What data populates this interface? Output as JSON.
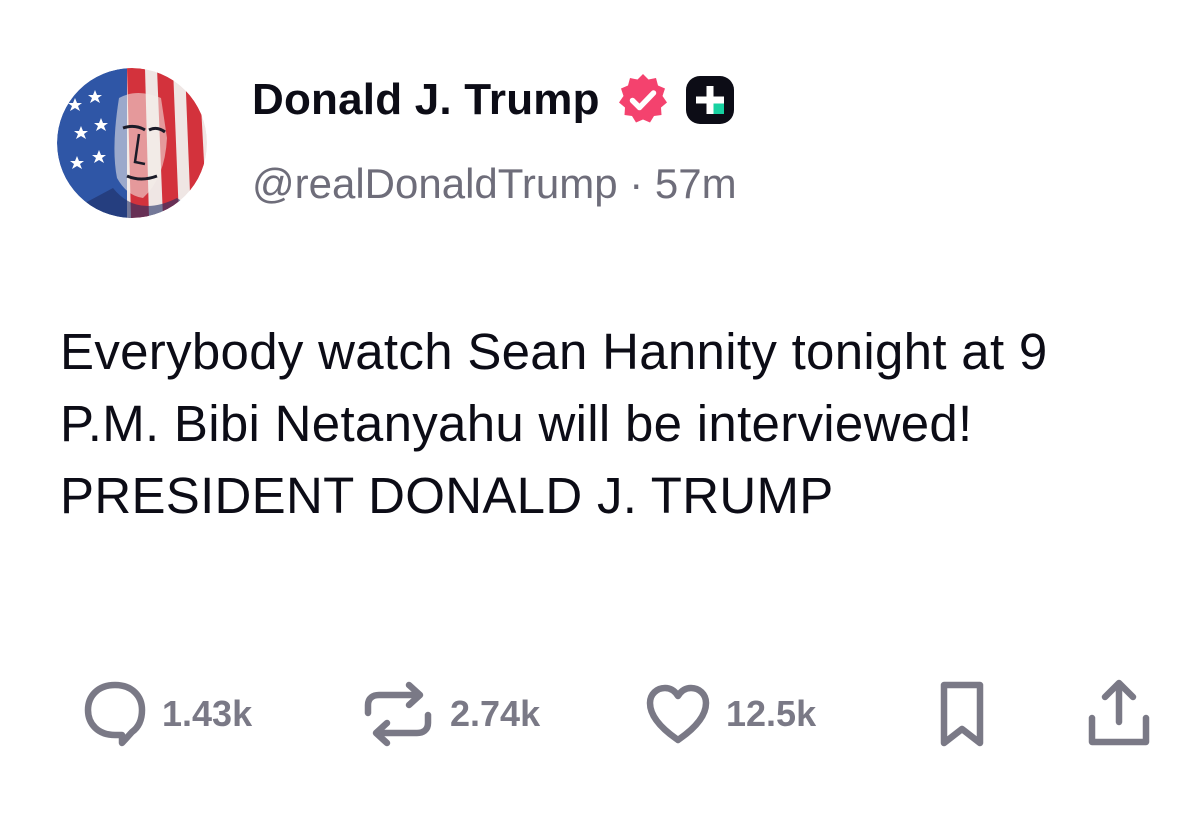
{
  "author": {
    "display_name": "Donald J. Trump",
    "handle": "@realDonaldTrump",
    "separator": "·",
    "time_ago": "57m",
    "verified_badge_icon": "verified-check-icon",
    "verified_badge_color": "#f4426e",
    "plus_badge_icon": "plus-badge-icon"
  },
  "post": {
    "text": "Everybody watch Sean Hannity tonight at 9 P.M. Bibi Netanyahu will be interviewed! PRESIDENT DONALD J. TRUMP"
  },
  "actions": {
    "replies": {
      "icon": "reply-bubble-icon",
      "count": "1.43k"
    },
    "retruths": {
      "icon": "repost-icon",
      "count": "2.74k"
    },
    "likes": {
      "icon": "heart-icon",
      "count": "12.5k"
    },
    "bookmark": {
      "icon": "bookmark-icon"
    },
    "share": {
      "icon": "share-icon"
    }
  },
  "colors": {
    "text": "#0c0c16",
    "muted": "#6e6d7a",
    "icon": "#7a7986"
  }
}
